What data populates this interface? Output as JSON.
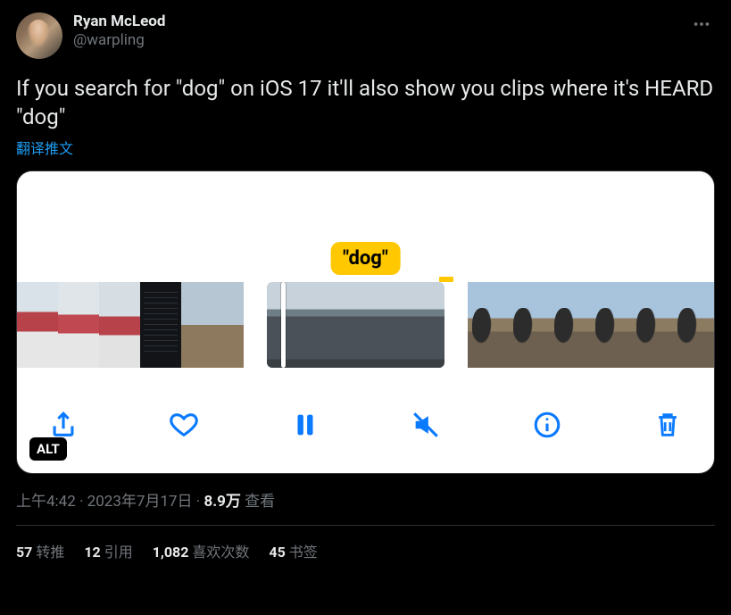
{
  "author": {
    "display_name": "Ryan McLeod",
    "handle": "@warpling"
  },
  "tweet_text": "If you search for \"dog\" on iOS 17 it'll also show you clips where it's HEARD \"dog\"",
  "translate_label": "翻译推文",
  "media": {
    "caption_bubble": "\"dog\"",
    "alt_badge": "ALT"
  },
  "meta": {
    "time": "上午4:42",
    "date": "2023年7月17日",
    "views_count": "8.9万",
    "views_label": "查看"
  },
  "stats": {
    "retweets": {
      "count": "57",
      "label": "转推"
    },
    "quotes": {
      "count": "12",
      "label": "引用"
    },
    "likes": {
      "count": "1,082",
      "label": "喜欢次数"
    },
    "bookmarks": {
      "count": "45",
      "label": "书签"
    }
  }
}
